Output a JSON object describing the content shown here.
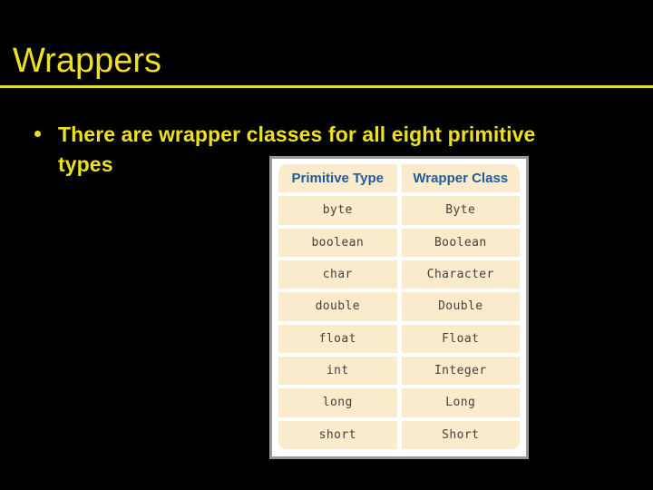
{
  "slide": {
    "title": "Wrappers",
    "background_color": "#000000",
    "accent_color": "#EDE020"
  },
  "bullets": [
    {
      "marker": "bullet-dot",
      "text": "There are wrapper classes for all eight primitive types"
    }
  ],
  "figure": {
    "name": "primitive-wrapper-table",
    "frame_color": "#9a9a9a",
    "cell_color": "#FAEBCD",
    "header_text_color": "#1F5C99",
    "headers": [
      "Primitive Type",
      "Wrapper Class"
    ],
    "rows": [
      [
        "byte",
        "Byte"
      ],
      [
        "boolean",
        "Boolean"
      ],
      [
        "char",
        "Character"
      ],
      [
        "double",
        "Double"
      ],
      [
        "float",
        "Float"
      ],
      [
        "int",
        "Integer"
      ],
      [
        "long",
        "Long"
      ],
      [
        "short",
        "Short"
      ]
    ]
  }
}
